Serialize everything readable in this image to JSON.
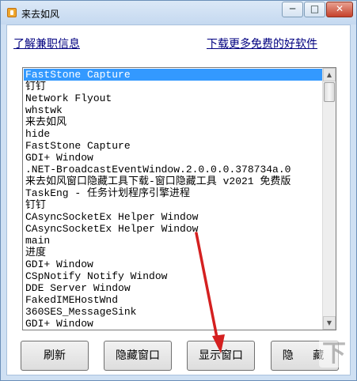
{
  "window": {
    "title": "来去如风",
    "buttons": {
      "minimize": "─",
      "maximize": "□",
      "close": "✕"
    },
    "icon": "app-icon"
  },
  "links": {
    "left": "了解兼职信息",
    "right": "下载更多免费的好软件"
  },
  "list": {
    "selected_index": 0,
    "items": [
      "FastStone Capture",
      "钉钉",
      "Network Flyout",
      "whstwk",
      "来去如风",
      "hide",
      "FastStone Capture",
      "GDI+ Window",
      ".NET-BroadcastEventWindow.2.0.0.0.378734a.0",
      "来去如风窗口隐藏工具下载-窗口隐藏工具 v2021 免费版",
      "TaskEng - 任务计划程序引擎进程",
      "钉钉",
      "CAsyncSocketEx Helper Window",
      "CAsyncSocketEx Helper Window",
      "main",
      "进度",
      "GDI+ Window",
      "CSpNotify Notify Window",
      "DDE Server Window",
      "FakedIMEHostWnd",
      "360SES_MessageSink",
      "GDI+ Window"
    ]
  },
  "actions": {
    "refresh": "刷新",
    "hide_window": "隐藏窗口",
    "show_window": "显示窗口",
    "hide": "隐 藏"
  },
  "colors": {
    "selection": "#3399ff",
    "link": "#000080",
    "annotation_arrow": "#d42020"
  }
}
